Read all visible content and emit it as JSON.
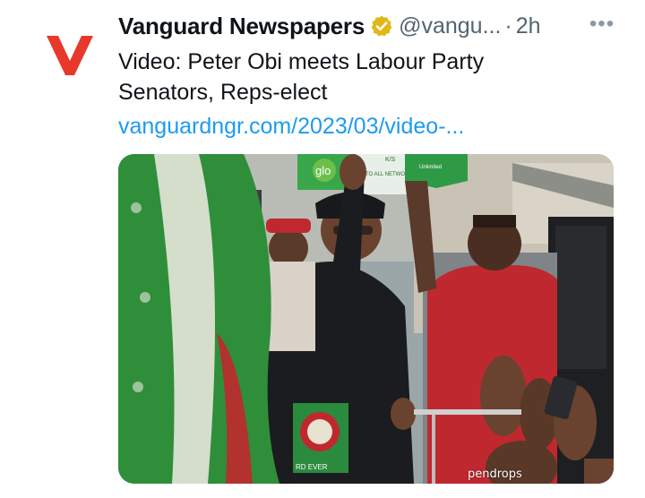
{
  "tweet": {
    "display_name": "Vanguard Newspapers",
    "handle": "@vangu...",
    "separator": "·",
    "time": "2h",
    "more_label": "•••",
    "text_lines": [
      "Video: Peter Obi meets Labour Party",
      "Senators, Reps-elect"
    ],
    "link": "vanguardngr.com/2023/03/video-...",
    "avatar_letter": "V",
    "media": {
      "watermark": "pendrops",
      "sign_text_1": "glo",
      "sign_text_2": "TO ALL NETWORKS",
      "sign_text_3": "Unlimited",
      "sign_text_4": "K/S",
      "poster_text": "RD EVER"
    }
  },
  "colors": {
    "brand_red": "#e8372b",
    "verified_gold": "#e2b719",
    "link_blue": "#1d9bf0",
    "muted": "#536471"
  },
  "icons": {
    "verified": "verified-badge-icon",
    "more": "more-horizontal-icon"
  }
}
